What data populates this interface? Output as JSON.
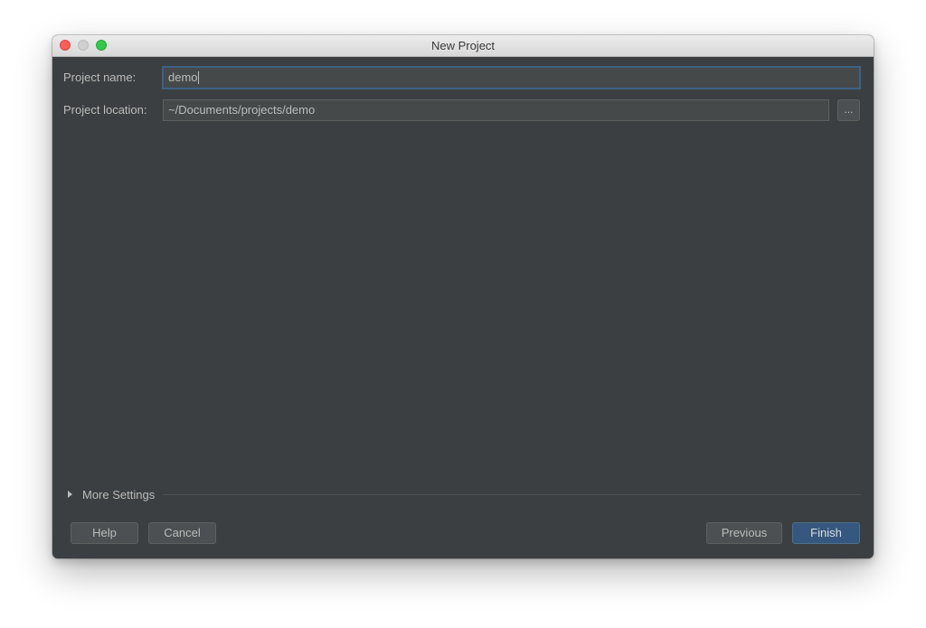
{
  "window": {
    "title": "New Project"
  },
  "form": {
    "project_name_label": "Project name:",
    "project_name_value": "demo",
    "project_location_label": "Project location:",
    "project_location_value": "~/Documents/projects/demo",
    "browse_label": "..."
  },
  "more_settings": {
    "label": "More Settings",
    "icon": "disclosure-triangle-right-icon"
  },
  "buttons": {
    "help": "Help",
    "cancel": "Cancel",
    "previous": "Previous",
    "finish": "Finish"
  },
  "colors": {
    "background": "#3c3f41",
    "text": "#bbbbbb",
    "focus_border": "#3d6185",
    "primary_button": "#365880"
  }
}
